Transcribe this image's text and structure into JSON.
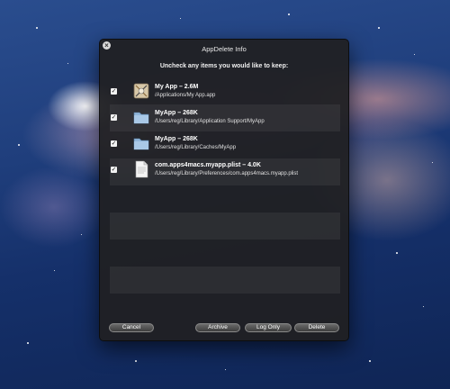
{
  "window": {
    "title": "AppDelete Info",
    "instruction": "Uncheck any items you would like to keep:"
  },
  "items": [
    {
      "name": "My App  –  2.6M",
      "path": "/Applications/My App.app",
      "checked": true,
      "icon": "app-icon"
    },
    {
      "name": "MyApp  –  268K",
      "path": "/Users/reg/Library/Application Support/MyApp",
      "checked": true,
      "icon": "folder-icon"
    },
    {
      "name": "MyApp  –  268K",
      "path": "/Users/reg/Library/Caches/MyApp",
      "checked": true,
      "icon": "folder-icon"
    },
    {
      "name": "com.apps4macs.myapp.plist  –  4.0K",
      "path": "/Users/reg/Library/Preferences/com.apps4macs.myapp.plist",
      "checked": true,
      "icon": "plist-file-icon"
    }
  ],
  "buttons": {
    "cancel": "Cancel",
    "archive": "Archive",
    "log_only": "Log Only",
    "delete": "Delete"
  }
}
